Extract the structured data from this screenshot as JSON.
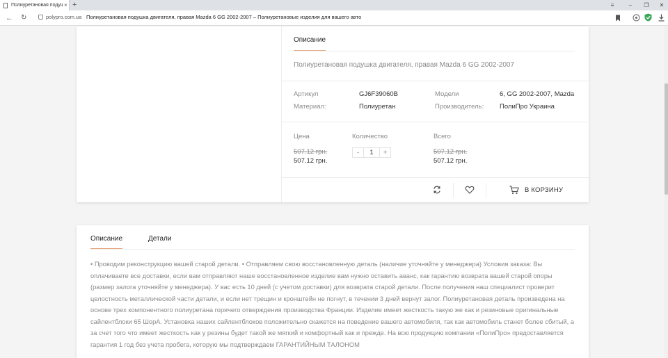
{
  "browser": {
    "tab_title": "Полиуретановая подуш",
    "tab_close": "×",
    "new_tab": "+",
    "domain": "polypro.com.ua",
    "page_title": "Полиуретановая подушка двигателя, правая Mazda 6 GG 2002-2007 – Полиуретановые изделия для вашего авто",
    "icons": [
      "back-icon",
      "reload-icon",
      "shield-icon",
      "bookmark-icon",
      "extension-icon",
      "adblock-icon",
      "download-icon"
    ]
  },
  "product": {
    "desc_tab": "Описание",
    "short_description": "Полиуретановая подушка двигателя, правая Mazda 6 GG 2002-2007",
    "sku_label": "Артикул",
    "sku": "GJ6F39060B",
    "material_label": "Материал:",
    "material": "Полиуретан",
    "models_label": "Модели",
    "models": "6, GG 2002-2007, Mazda",
    "manufacturer_label": "Производитель:",
    "manufacturer": "ПолиПро Украина",
    "price_label": "Цена",
    "price_old": "507.12 грн.",
    "price": "507.12 грн.",
    "qty_label": "Количество",
    "qty_minus": "-",
    "qty_value": "1",
    "qty_plus": "+",
    "total_label": "Всего",
    "total_old": "507.12 грн.",
    "total": "507.12 грн.",
    "cart_label": "В КОРЗИНУ"
  },
  "details": {
    "tabs": [
      "Описание",
      "Детали"
    ],
    "active_tab": 0,
    "description": "• Проводим реконструкцию вашей старой детали. • Отправляем свою восстановленную деталь (наличие уточняйте у менеджера) Условия заказа: Вы оплачиваете все доставки, если вам отправляют наше восстановленное изделие вам нужно оставить аванс, как гарантию возврата вашей старой опоры (размер залога уточняйте у менеджера). У вас есть 10 дней (с учетом доставки) для возврата старой детали. После получения наш специалист проверит целостность металлической части детали, и если нет трещин и кронштейн не погнут, в течении 3 дней вернут залог. Полиуретановая деталь произведена на основе трех компонентного полиуретана горячего отверждения производства Франции. Изделие имеет жесткость такую же как и резиновые оригинальные сайлентблоки 65 ШорА. Установка наших сайлентблоков положительно скажется на поведение вашего автомобиля, так как автомобиль станет более сбитый, а за счет того что имеет жесткость как у резины будет такой же мягкий и комфортный как и прежде. На всю продукцию компании «ПолиПро» предоставляется гарантия 1 год без учета пробега, которую мы подтверждаем ГАРАНТИЙНЫМ ТАЛОНОМ"
  },
  "colors": {
    "accent": "#e5a882",
    "page_bg": "#f4f4f4",
    "adblock_green": "#3aa757"
  }
}
